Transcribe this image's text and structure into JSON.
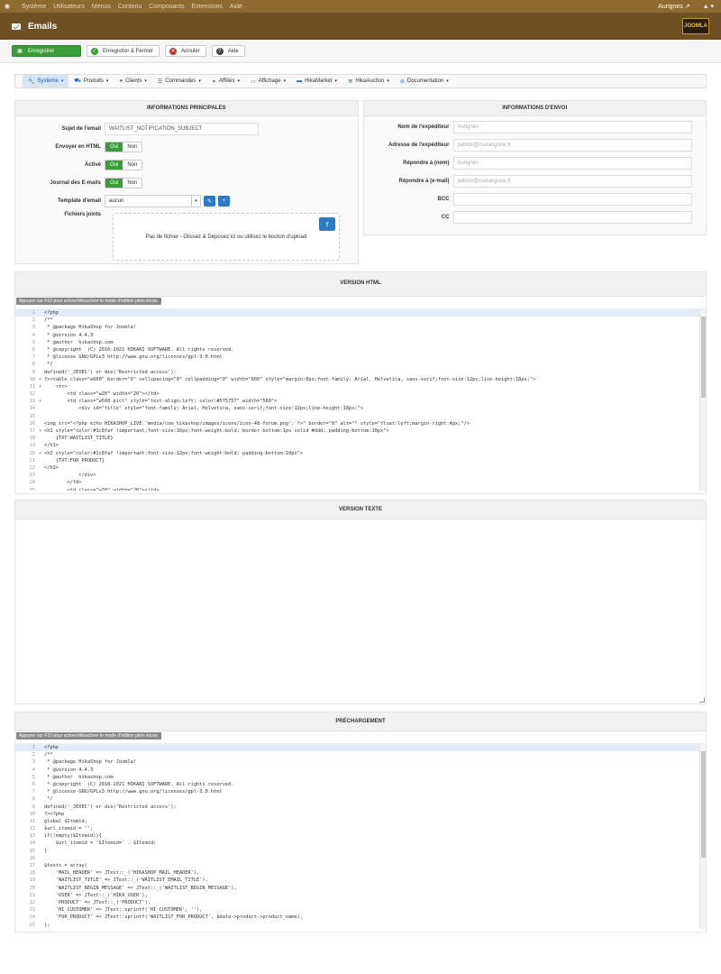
{
  "topnav": {
    "menu": [
      "Système",
      "Utilisateurs",
      "Menus",
      "Contenu",
      "Composants",
      "Extensions",
      "Aide"
    ],
    "site": "Aurignes ↗",
    "user": "▲ ▾"
  },
  "title": "Emails",
  "brand": "JOOMLA",
  "toolbar": {
    "save": "Enregistrer",
    "save_close": "Enregistrer & Fermer",
    "cancel": "Annuler",
    "help": "Aide"
  },
  "hikamenu": [
    {
      "label": "Système",
      "icon": "wrench-icon",
      "active": true
    },
    {
      "label": "Produits",
      "icon": "cart-icon"
    },
    {
      "label": "Clients",
      "icon": "user-icon"
    },
    {
      "label": "Commandes",
      "icon": "list-icon"
    },
    {
      "label": "Affiliés",
      "icon": "link-icon"
    },
    {
      "label": "Affichage",
      "icon": "monitor-icon"
    },
    {
      "label": "HikaMarket",
      "icon": "store-icon"
    },
    {
      "label": "HikaAuction",
      "icon": "hammer-icon"
    },
    {
      "label": "Documentation",
      "icon": "help-circle-icon"
    }
  ],
  "main_info": {
    "header": "INFORMATIONS PRINCIPALES",
    "subject_label": "Sujet de l'email",
    "subject_value": "WAITLIST_NOTIFICATION_SUBJECT",
    "html_label": "Envoyer en HTML",
    "active_label": "Activé",
    "log_label": "Journal des E-mails",
    "yes": "Oui",
    "no": "Non",
    "template_label": "Template d'email",
    "template_value": "aucun",
    "attachments_label": "Fichiers joints",
    "dropzone_text": "Pas de fichier - Glissez & Déposez ici ou utilisez le bouton d'upload"
  },
  "send_info": {
    "header": "INFORMATIONS D'ENVOI",
    "sender_name_label": "Nom de l'expéditeur",
    "sender_name_value": "Aurignes",
    "sender_addr_label": "Adresse de l'expéditeur",
    "sender_addr_value": "patrick@marangone.fr",
    "reply_name_label": "Répondre à (nom)",
    "reply_name_value": "Aurignes",
    "reply_email_label": "Répondre à (e-mail)",
    "reply_email_value": "patrick@marangone.fr",
    "bcc_label": "BCC",
    "cc_label": "CC"
  },
  "html_version": {
    "header": "VERSION HTML",
    "hint": "Appuyer sur F10 pour activer/désactiver le mode d'édition plein écran.",
    "lines": [
      "<?php",
      "/**",
      " * @package HikaShop for Joomla!",
      " * @version 4.4.3",
      " * @author  hikashop.com",
      " * @copyright  (C) 2010-2021 HIKARI SOFTWARE. All rights reserved.",
      " * @license GNU/GPLv3 http://www.gnu.org/licenses/gpl-3.0.html",
      " */",
      "defined('_JEXEC') or die('Restricted access');",
      "?><table class=\"w600\" border=\"0\" cellspacing=\"0\" cellpadding=\"0\" width=\"600\" style=\"margin:0px;font-family: Arial, Helvetica, sans-serif;font-size:12px;line-height:18px;\">",
      "    <tr>",
      "        <td class=\"w20\" width=\"20\"></td>",
      "        <td class=\"w560 pict\" style=\"text-align:left; color:#575757\" width=\"560\">",
      "            <div id=\"title\" style=\"font-family: Arial, Helvetica, sans-serif;font-size:12px;line-height:18px;\">",
      "",
      "<img src=\"<?php echo HIKASHOP_LIVE.'media/com_hikashop/images/icons/icon-48-forum.png'; ?>\" border=\"0\" alt=\"\" style=\"float:left;margin-right:4px;\"/>",
      "<h1 style=\"color:#1c8faf !important;font-size:16px;font-weight:bold; border-bottom:1px solid #ddd; padding-bottom:10px\">",
      "    {TXT:WAITLIST_TITLE}",
      "</h1>",
      "<h2 style=\"color:#1c8faf !important;font-size:12px;font-weight:bold; padding-bottom:10px\">",
      "    {TXT:FOR_PRODUCT}",
      "</h2>",
      "            </div>",
      "        </td>",
      "        <td class=\"w20\" width=\"20\"></td>"
    ]
  },
  "text_version": {
    "header": "VERSION TEXTE"
  },
  "preload": {
    "header": "PRÉCHARGEMENT",
    "hint": "Appuyer sur F10 pour activer/désactiver le mode d'édition plein écran.",
    "lines": [
      "<?php",
      "/**",
      " * @package HikaShop for Joomla!",
      " * @version 4.4.3",
      " * @author  hikashop.com",
      " * @copyright  (C) 2010-2021 HIKARI SOFTWARE. All rights reserved.",
      " * @license GNU/GPLv3 http://www.gnu.org/licenses/gpl-3.0.html",
      " */",
      "defined('_JEXEC') or die('Restricted access');",
      "?><?php",
      "global $Itemid;",
      "$url_itemid = '';",
      "if(!empty($Itemid)){",
      "    $url_itemid = '&Itemid=' . $Itemid;",
      "}",
      "",
      "$texts = array(",
      "    'MAIL_HEADER' => JText::_('HIKASHOP_MAIL_HEADER'),",
      "    'WAITLIST_TITLE' => JText::_('WAITLIST_EMAIL_TITLE'),",
      "    'WAITLIST_BEGIN_MESSAGE' => JText::_('WAITLIST_BEGIN_MESSAGE'),",
      "    'USER' => JText::_('HIKA_USER'),",
      "    'PRODUCT' => JText::_('PRODUCT'),",
      "    'HI_CUSTOMER' => JText::sprintf('HI_CUSTOMER', ''),",
      "    'FOR_PRODUCT' => JText::sprintf('WAITLIST_FOR_PRODUCT', $data->product->product_name),",
      ");"
    ]
  }
}
